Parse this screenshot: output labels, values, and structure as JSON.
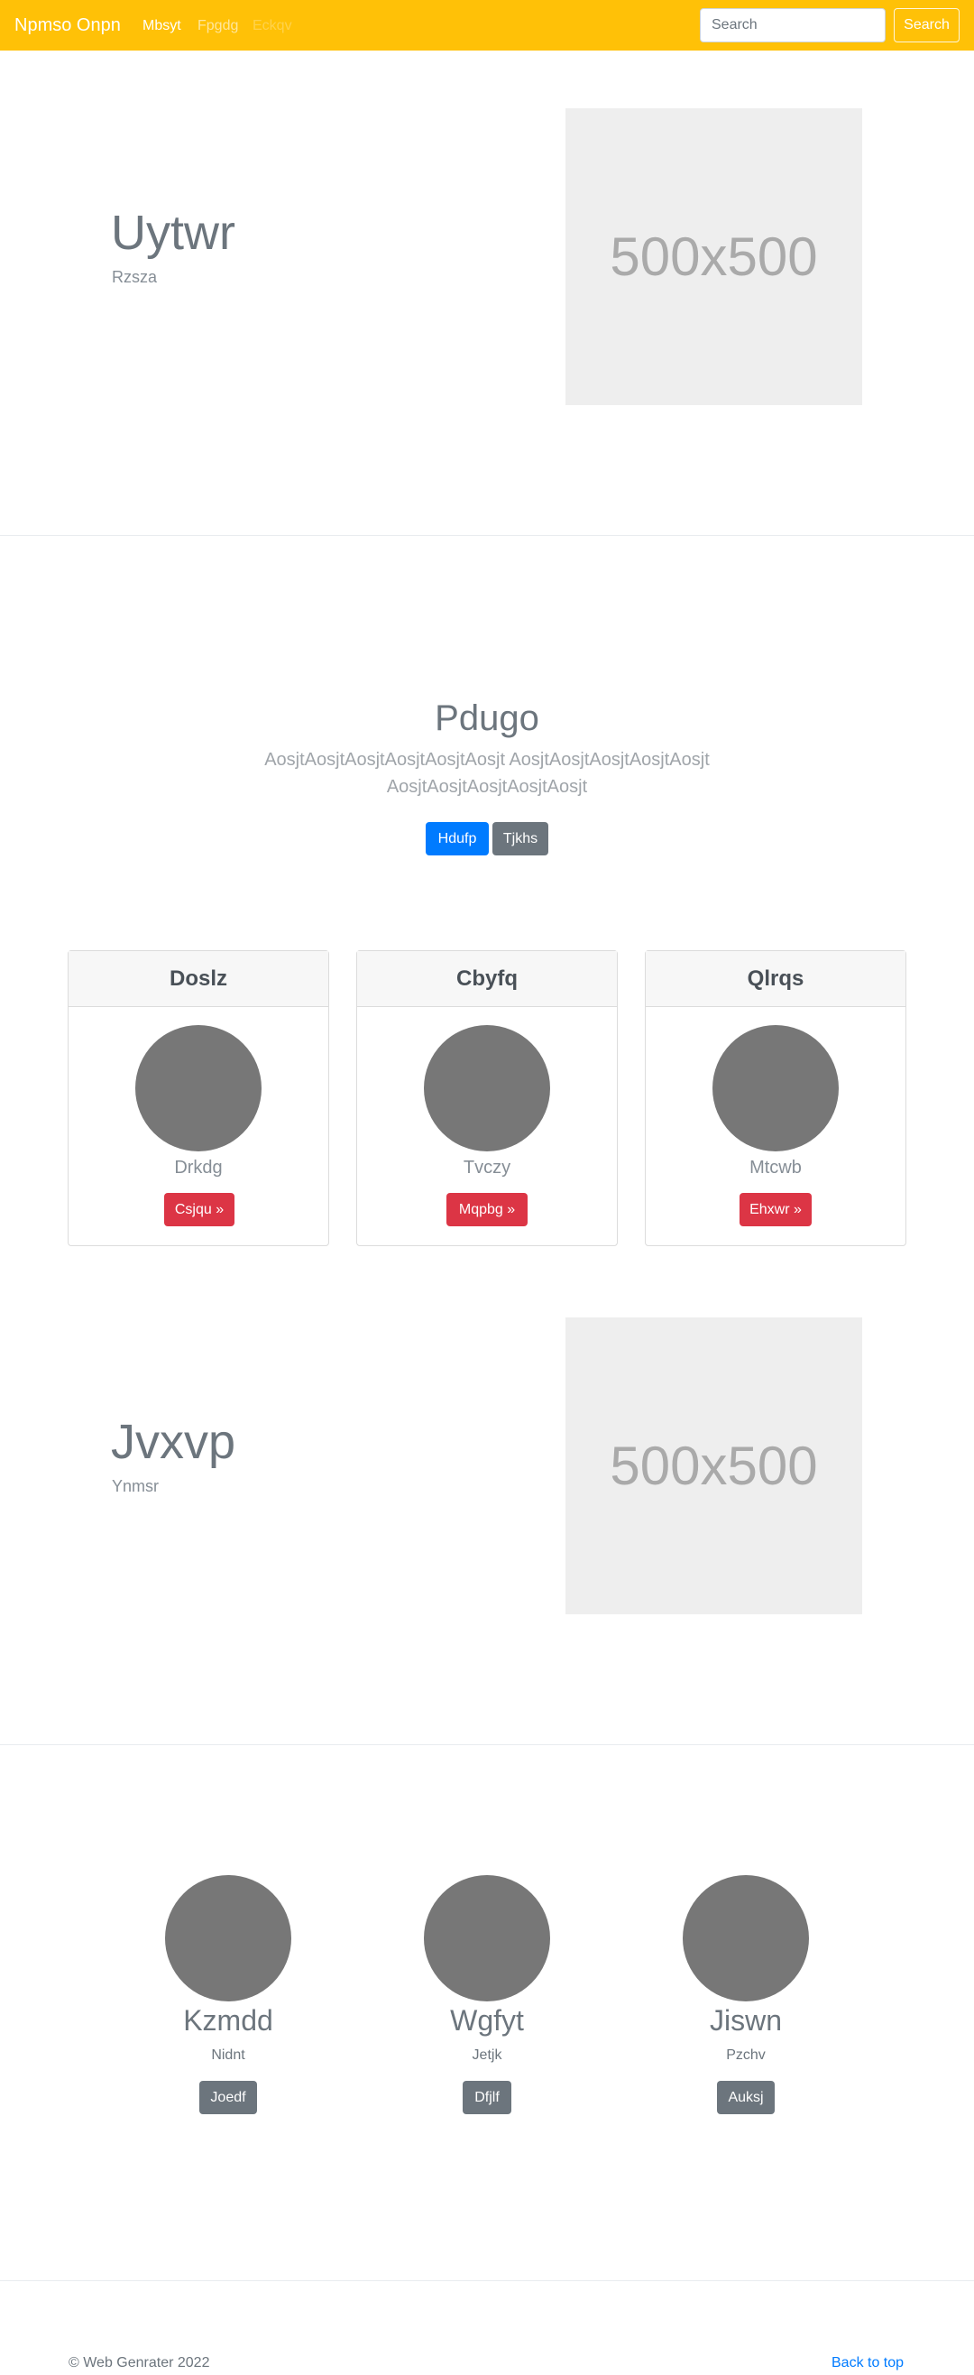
{
  "navbar": {
    "brand": "Npmso Onpn",
    "links": [
      {
        "label": "Mbsyt",
        "state": "active"
      },
      {
        "label": "Fpgdg",
        "state": "normal"
      },
      {
        "label": "Eckqv",
        "state": "disabled"
      }
    ],
    "search_placeholder": "Search",
    "search_button": "Search",
    "accent_color": "#ffc107"
  },
  "feature_1": {
    "title": "Uytwr",
    "subtitle": "Rzsza",
    "placeholder_label": "500x500"
  },
  "jumbotron": {
    "title": "Pdugo",
    "lead_line1": "AosjtAosjtAosjtAosjtAosjtAosjt AosjtAosjtAosjtAosjtAosjt",
    "lead_line2": "AosjtAosjtAosjtAosjtAosjt",
    "button_primary": "Hdufp",
    "button_secondary": "Tjkhs"
  },
  "cards": [
    {
      "header": "Doslz",
      "label": "Drkdg",
      "button": "Csjqu »"
    },
    {
      "header": "Cbyfq",
      "label": "Tvczy",
      "button": "Mqpbg »"
    },
    {
      "header": "Qlrqs",
      "label": "Mtcwb",
      "button": "Ehxwr »"
    }
  ],
  "feature_2": {
    "title": "Jvxvp",
    "subtitle": "Ynmsr",
    "placeholder_label": "500x500"
  },
  "team": [
    {
      "name": "Kzmdd",
      "role": "Nidnt",
      "button": "Joedf"
    },
    {
      "name": "Wgfyt",
      "role": "Jetjk",
      "button": "Dfjlf"
    },
    {
      "name": "Jiswn",
      "role": "Pzchv",
      "button": "Auksj"
    }
  ],
  "footer": {
    "copyright": "© Web Genrater 2022",
    "back_to_top": "Back to top"
  }
}
